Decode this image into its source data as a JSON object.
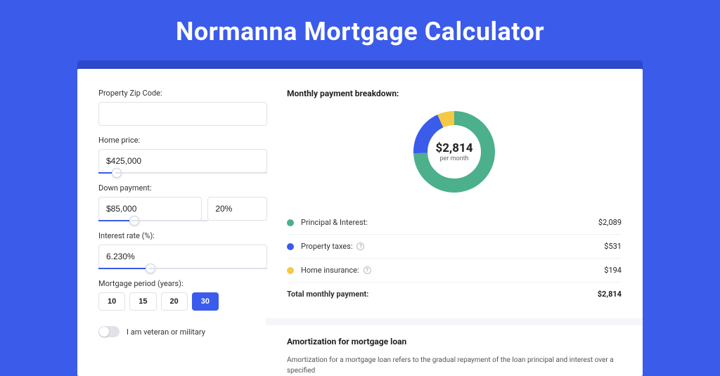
{
  "title": "Normanna Mortgage Calculator",
  "form": {
    "zip_label": "Property Zip Code:",
    "zip_value": "",
    "price_label": "Home price:",
    "price_value": "$425,000",
    "down_label": "Down payment:",
    "down_value": "$85,000",
    "down_pct": "20%",
    "rate_label": "Interest rate (%):",
    "rate_value": "6.230%",
    "period_label": "Mortgage period (years):",
    "periods": [
      "10",
      "15",
      "20",
      "30"
    ],
    "period_active": "30",
    "veteran_label": "I am veteran or military"
  },
  "breakdown": {
    "title": "Monthly payment breakdown:",
    "total_amount": "$2,814",
    "total_sub": "per month",
    "items": [
      {
        "label": "Principal & Interest:",
        "value": "$2,089",
        "color": "green"
      },
      {
        "label": "Property taxes:",
        "value": "$531",
        "color": "blue",
        "info": true
      },
      {
        "label": "Home insurance:",
        "value": "$194",
        "color": "yellow",
        "info": true
      }
    ],
    "total_label": "Total monthly payment:",
    "total_value": "$2,814"
  },
  "amort": {
    "title": "Amortization for mortgage loan",
    "text": "Amortization for a mortgage loan refers to the gradual repayment of the loan principal and interest over a specified"
  },
  "chart_data": {
    "type": "pie",
    "title": "Monthly payment breakdown",
    "series": [
      {
        "name": "Principal & Interest",
        "value": 2089,
        "color": "#4BB08B"
      },
      {
        "name": "Property taxes",
        "value": 531,
        "color": "#3B5BEB"
      },
      {
        "name": "Home insurance",
        "value": 194,
        "color": "#F5C945"
      }
    ],
    "total": 2814
  }
}
